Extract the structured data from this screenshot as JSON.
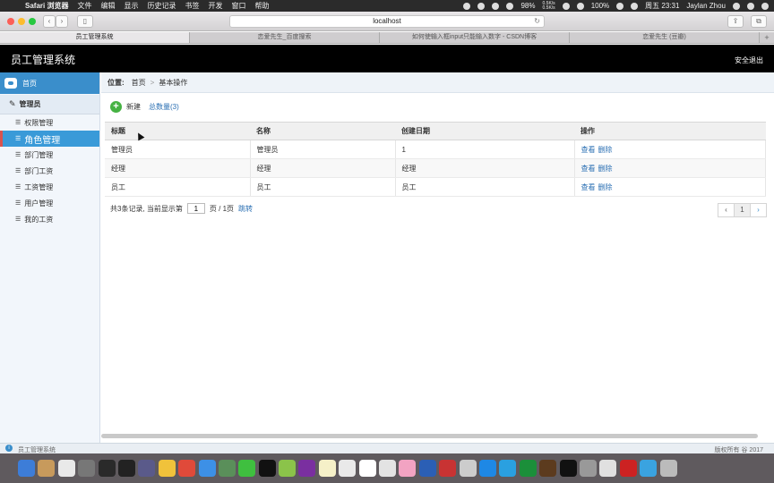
{
  "menubar": {
    "app_name": "Safari 浏览器",
    "menus": [
      "文件",
      "编辑",
      "显示",
      "历史记录",
      "书签",
      "开发",
      "窗口",
      "帮助"
    ],
    "battery": "98%",
    "net_up": "0.5K/s",
    "net_down": "0.5K/s",
    "wifi_strength": "100%",
    "datetime": "周五 23:31",
    "user": "Jaylan Zhou"
  },
  "browser": {
    "url": "localhost",
    "tabs": [
      "员工管理系统",
      "恋爱先生_百度搜索",
      "如何使输入框input只能输入数字 - CSDN博客",
      "恋爱先生 (豆瓣)"
    ],
    "tab_add": "+"
  },
  "app": {
    "title": "员工管理系统",
    "logout": "安全退出"
  },
  "sidebar": {
    "home": "首页",
    "group": "管理员",
    "items": [
      "权限管理",
      "角色管理",
      "部门管理",
      "部门工资",
      "工资管理",
      "用户管理",
      "我的工资"
    ],
    "active_index": 1
  },
  "breadcrumb": {
    "label": "位置:",
    "home": "首页",
    "sep": ">",
    "current": "基本操作"
  },
  "toolbar": {
    "new_label": "新建",
    "total_label": "总数量(3)"
  },
  "table": {
    "columns": [
      "标题",
      "名称",
      "创建日期",
      "操作"
    ],
    "rows": [
      {
        "title": "管理员",
        "name": "管理员",
        "date": "1",
        "view": "查看",
        "del": "删除"
      },
      {
        "title": "经理",
        "name": "经理",
        "date": "经理",
        "view": "查看",
        "del": "删除"
      },
      {
        "title": "员工",
        "name": "员工",
        "date": "员工",
        "view": "查看",
        "del": "删除"
      }
    ]
  },
  "pager": {
    "summary": "共3条记录,  当前显示第",
    "page_value": "1",
    "of_pages": "页 / 1页",
    "go": "跳转",
    "prev": "‹",
    "current": "1",
    "next": "›"
  },
  "statusbar": {
    "name": "员工管理系统",
    "copyright": "版权所有 谷 2017"
  },
  "dock_colors": [
    "#3d7dd8",
    "#c79a5c",
    "#e9e9e9",
    "#777777",
    "#2a2a2a",
    "#222222",
    "#5a5a8a",
    "#f0c23b",
    "#e04a3a",
    "#3d90e6",
    "#5a8f5a",
    "#3fbf3f",
    "#111111",
    "#8bc34a",
    "#7a2fa0",
    "#f5f0c8",
    "#e9e9e9",
    "#ffffff",
    "#e3e3e3",
    "#f2a3c2",
    "#2b5fb5",
    "#c83333",
    "#cccccc",
    "#1e88e5",
    "#2aa0e0",
    "#1b8f3a",
    "#5c3b1e",
    "#111111",
    "#999999",
    "#e0e0e0",
    "#cc2222",
    "#3aa3e0",
    "#bbbbbb"
  ]
}
